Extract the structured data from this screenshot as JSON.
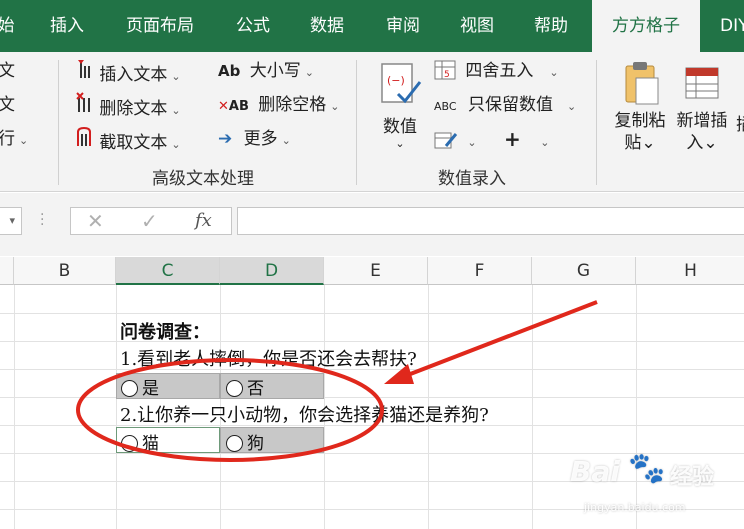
{
  "ribbon_tabs": {
    "partial": "始",
    "insert": "插入",
    "layout": "页面布局",
    "formula": "公式",
    "data": "数据",
    "review": "审阅",
    "view": "视图",
    "help": "帮助",
    "ffgz": "方方格子",
    "diy": "DIY"
  },
  "ribbon": {
    "left_partial": [
      "文",
      "文",
      "行"
    ],
    "text_group": {
      "insert_text": "插入文本",
      "delete_text": "删除文本",
      "extract_text": "截取文本",
      "case": "大小写",
      "remove_spaces": "删除空格",
      "more": "更多",
      "label": "高级文本处理"
    },
    "number_group": {
      "value": "数值",
      "round": "四舍五入",
      "keep_numeric": "只保留数值",
      "label": "数值录入"
    },
    "copy_paste": [
      "复制粘",
      "贴"
    ],
    "add_insert": [
      "新增插",
      "入"
    ],
    "partial_right": "插"
  },
  "formula_bar": {
    "cancel": "✕",
    "confirm": "✓",
    "fx": "fx",
    "value": ""
  },
  "columns": [
    "B",
    "C",
    "D",
    "E",
    "F",
    "G",
    "H"
  ],
  "survey": {
    "title": "问卷调查：",
    "q1": "1.看到老人摔倒，你是否还会去帮扶?",
    "q1_options": [
      "是",
      "否"
    ],
    "q2": "2.让你养一只小动物，你会选择养猫还是养狗?",
    "q2_options": [
      "猫",
      "狗"
    ]
  },
  "watermark": {
    "brand": "Bai",
    "brand2": "经验",
    "url": "jingyan.baidu.com"
  },
  "colors": {
    "excel_green": "#217346",
    "annotation_red": "#e0281c",
    "option_gray": "#c8c8c8"
  }
}
